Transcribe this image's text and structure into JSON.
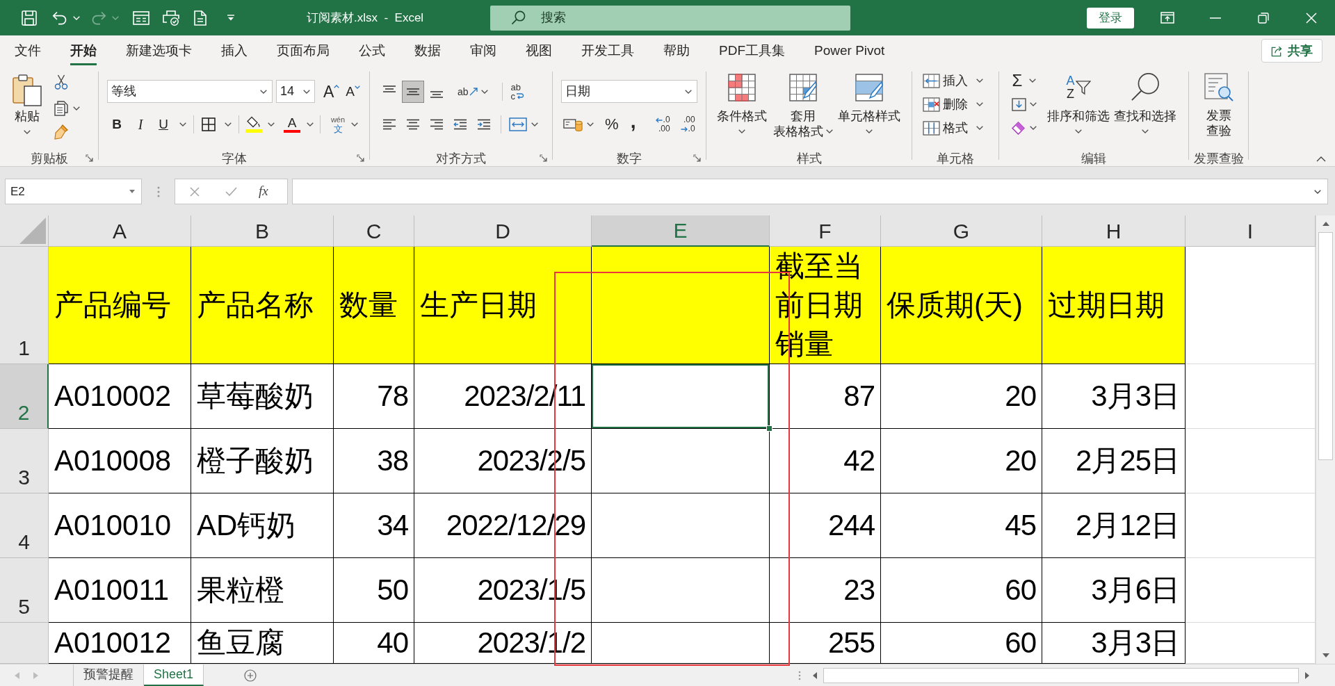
{
  "window": {
    "title": "订阅素材.xlsx  -  Excel",
    "sign_in_button": "登录"
  },
  "search": {
    "placeholder": "搜索"
  },
  "quick_access": {
    "undo": {
      "disabled": false
    },
    "redo": {
      "disabled": true
    }
  },
  "ribbon_tabs": [
    {
      "label": "文件",
      "selected": false
    },
    {
      "label": "开始",
      "selected": true
    },
    {
      "label": "新建选项卡",
      "selected": false
    },
    {
      "label": "插入",
      "selected": false
    },
    {
      "label": "页面布局",
      "selected": false
    },
    {
      "label": "公式",
      "selected": false
    },
    {
      "label": "数据",
      "selected": false
    },
    {
      "label": "审阅",
      "selected": false
    },
    {
      "label": "视图",
      "selected": false
    },
    {
      "label": "开发工具",
      "selected": false
    },
    {
      "label": "帮助",
      "selected": false
    },
    {
      "label": "PDF工具集",
      "selected": false
    },
    {
      "label": "Power Pivot",
      "selected": false
    }
  ],
  "share_button": "共享",
  "ribbon": {
    "clipboard": {
      "label": "剪贴板",
      "paste": "粘贴"
    },
    "font": {
      "label": "字体",
      "font_name": "等线",
      "font_size": "14",
      "grow": "A",
      "shrink": "A",
      "bold": "B",
      "italic": "I",
      "underline": "U",
      "font_color": "A",
      "phonetic": [
        "wén",
        "文"
      ]
    },
    "alignment": {
      "label": "对齐方式",
      "vertical": [
        {
          "kind": "top",
          "selected": false
        },
        {
          "kind": "middle",
          "selected": true
        },
        {
          "kind": "bottom",
          "selected": false
        }
      ],
      "orientation": "ab",
      "wrap": [
        "ab",
        "c"
      ]
    },
    "number": {
      "label": "数字",
      "format": "日期",
      "percent": "%",
      "comma": ",",
      "increase_decimal": [
        ".0",
        ".00"
      ],
      "decrease_decimal": [
        ".00",
        ".0"
      ]
    },
    "styles": {
      "label": "样式",
      "buttons": [
        {
          "kind": "conditional",
          "lines": [
            "条件格式"
          ]
        },
        {
          "kind": "table",
          "lines": [
            "套用",
            "表格格式"
          ]
        },
        {
          "kind": "cell",
          "lines": [
            "单元格样式"
          ]
        }
      ]
    },
    "cells": {
      "label": "单元格",
      "buttons": [
        {
          "kind": "insert",
          "label": "插入"
        },
        {
          "kind": "delete",
          "label": "删除"
        },
        {
          "kind": "format",
          "label": "格式"
        }
      ]
    },
    "editing": {
      "label": "编辑",
      "autosum": "Σ",
      "sort": {
        "letters": [
          "A",
          "Z"
        ],
        "label": "排序和筛选"
      },
      "find": "查找和选择"
    },
    "invoice": {
      "label": "发票查验",
      "lines": [
        "发票",
        "查验"
      ]
    }
  },
  "formula_bar": {
    "name_box": "E2",
    "function_button": "fx"
  },
  "sheet": {
    "columns": [
      {
        "label": "A",
        "selected": false
      },
      {
        "label": "B",
        "selected": false
      },
      {
        "label": "C",
        "selected": false
      },
      {
        "label": "D",
        "selected": false
      },
      {
        "label": "E",
        "selected": true
      },
      {
        "label": "F",
        "selected": false
      },
      {
        "label": "G",
        "selected": false
      },
      {
        "label": "H",
        "selected": false
      },
      {
        "label": "I",
        "selected": false
      }
    ],
    "rows": [
      {
        "number": "1",
        "selected": false,
        "kind": "header",
        "cells": [
          {
            "kind": "text",
            "text": "产品编号",
            "selected": false
          },
          {
            "kind": "text",
            "text": "产品名称",
            "selected": false
          },
          {
            "kind": "text",
            "text": "数量",
            "selected": false
          },
          {
            "kind": "text",
            "text": "生产日期",
            "selected": false
          },
          {
            "kind": "empty",
            "selected": false
          },
          {
            "kind": "text",
            "text": "截至当前日期销量",
            "selected": false
          },
          {
            "kind": "text",
            "text": "保质期(天)",
            "selected": false
          },
          {
            "kind": "text",
            "text": "过期日期",
            "selected": false
          }
        ]
      },
      {
        "number": "2",
        "selected": true,
        "kind": "data",
        "cells": [
          {
            "kind": "text",
            "text": "A010002",
            "selected": false
          },
          {
            "kind": "text",
            "text": "草莓酸奶",
            "selected": false
          },
          {
            "kind": "number",
            "text": "78",
            "selected": false
          },
          {
            "kind": "number",
            "text": "2023/2/11",
            "selected": false
          },
          {
            "kind": "empty",
            "selected": true
          },
          {
            "kind": "number",
            "text": "87",
            "selected": false
          },
          {
            "kind": "number",
            "text": "20",
            "selected": false
          },
          {
            "kind": "number",
            "text": "3月3日",
            "selected": false
          }
        ]
      },
      {
        "number": "3",
        "selected": false,
        "kind": "data",
        "cells": [
          {
            "kind": "text",
            "text": "A010008",
            "selected": false
          },
          {
            "kind": "text",
            "text": "橙子酸奶",
            "selected": false
          },
          {
            "kind": "number",
            "text": "38",
            "selected": false
          },
          {
            "kind": "number",
            "text": "2023/2/5",
            "selected": false
          },
          {
            "kind": "empty",
            "selected": false
          },
          {
            "kind": "number",
            "text": "42",
            "selected": false
          },
          {
            "kind": "number",
            "text": "20",
            "selected": false
          },
          {
            "kind": "number",
            "text": "2月25日",
            "selected": false
          }
        ]
      },
      {
        "number": "4",
        "selected": false,
        "kind": "data",
        "cells": [
          {
            "kind": "text",
            "text": "A010010",
            "selected": false
          },
          {
            "kind": "text",
            "text": "AD钙奶",
            "selected": false
          },
          {
            "kind": "number",
            "text": "34",
            "selected": false
          },
          {
            "kind": "number",
            "text": "2022/12/29",
            "selected": false
          },
          {
            "kind": "empty",
            "selected": false
          },
          {
            "kind": "number",
            "text": "244",
            "selected": false
          },
          {
            "kind": "number",
            "text": "45",
            "selected": false
          },
          {
            "kind": "number",
            "text": "2月12日",
            "selected": false
          }
        ]
      },
      {
        "number": "5",
        "selected": false,
        "kind": "data",
        "cells": [
          {
            "kind": "text",
            "text": "A010011",
            "selected": false
          },
          {
            "kind": "text",
            "text": "果粒橙",
            "selected": false
          },
          {
            "kind": "number",
            "text": "50",
            "selected": false
          },
          {
            "kind": "number",
            "text": "2023/1/5",
            "selected": false
          },
          {
            "kind": "empty",
            "selected": false
          },
          {
            "kind": "number",
            "text": "23",
            "selected": false
          },
          {
            "kind": "number",
            "text": "60",
            "selected": false
          },
          {
            "kind": "number",
            "text": "3月6日",
            "selected": false
          }
        ]
      },
      {
        "selected": false,
        "kind": "data",
        "cells": [
          {
            "kind": "text",
            "text": "A010012",
            "selected": false
          },
          {
            "kind": "text",
            "text": "鱼豆腐",
            "selected": false
          },
          {
            "kind": "number",
            "text": "40",
            "selected": false
          },
          {
            "kind": "number",
            "text": "2023/1/2",
            "selected": false
          },
          {
            "kind": "empty",
            "selected": false
          },
          {
            "kind": "number",
            "text": "255",
            "selected": false
          },
          {
            "kind": "number",
            "text": "60",
            "selected": false
          },
          {
            "kind": "number",
            "text": "3月3日",
            "selected": false
          }
        ]
      }
    ]
  },
  "sheet_tabs": [
    {
      "label": "预警提醒",
      "selected": false
    },
    {
      "label": "Sheet1",
      "selected": true
    }
  ]
}
